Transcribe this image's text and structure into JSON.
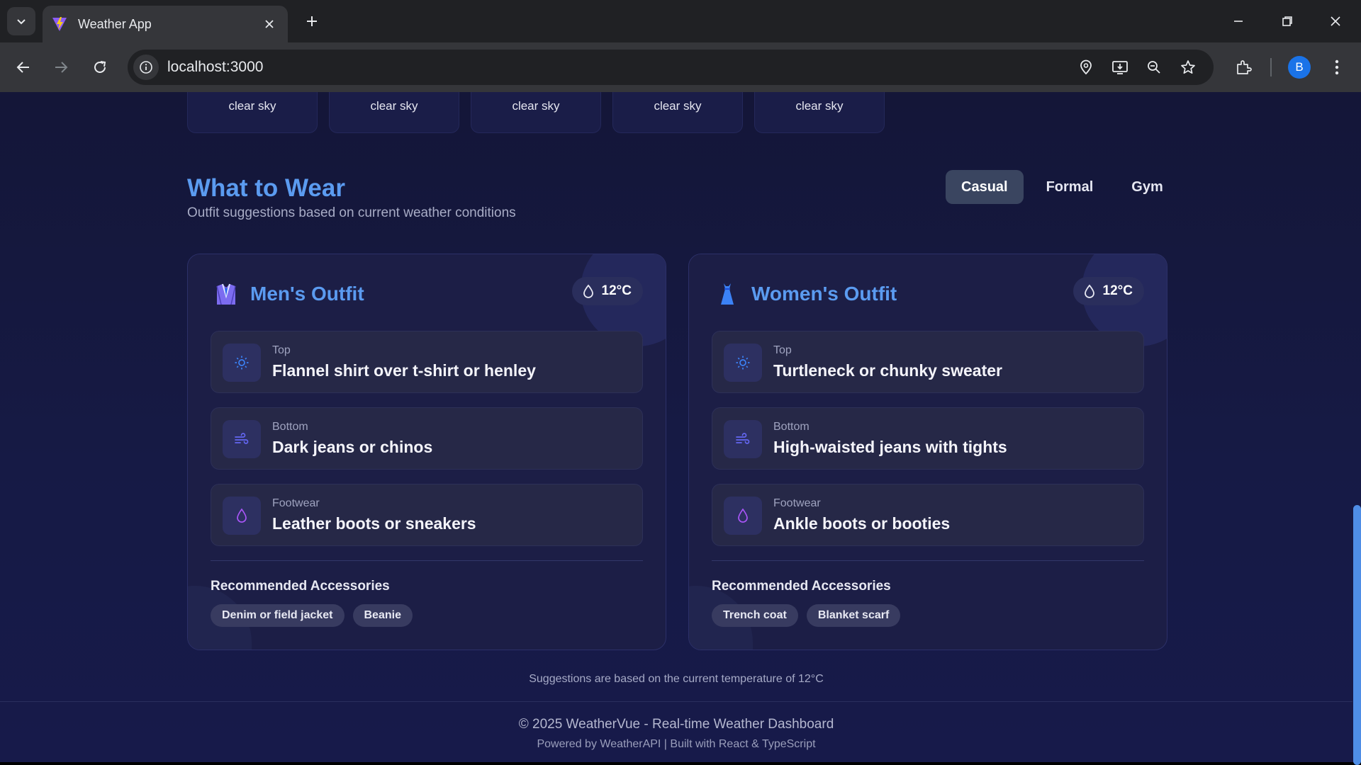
{
  "browser": {
    "tab_title": "Weather App",
    "url": "localhost:3000",
    "profile_initial": "B"
  },
  "forecast": {
    "descriptions": [
      "clear sky",
      "clear sky",
      "clear sky",
      "clear sky",
      "clear sky"
    ]
  },
  "wear": {
    "title": "What to Wear",
    "subtitle": "Outfit suggestions based on current weather conditions",
    "styles": [
      "Casual",
      "Formal",
      "Gym"
    ],
    "active_style": "Casual"
  },
  "men": {
    "title": "Men's Outfit",
    "temp": "12°C",
    "top_label": "Top",
    "top_value": "Flannel shirt over t-shirt or henley",
    "bottom_label": "Bottom",
    "bottom_value": "Dark jeans or chinos",
    "footwear_label": "Footwear",
    "footwear_value": "Leather boots or sneakers",
    "accessories_title": "Recommended Accessories",
    "accessories": [
      "Denim or field jacket",
      "Beanie"
    ]
  },
  "women": {
    "title": "Women's Outfit",
    "temp": "12°C",
    "top_label": "Top",
    "top_value": "Turtleneck or chunky sweater",
    "bottom_label": "Bottom",
    "bottom_value": "High-waisted jeans with tights",
    "footwear_label": "Footwear",
    "footwear_value": "Ankle boots or booties",
    "accessories_title": "Recommended Accessories",
    "accessories": [
      "Trench coat",
      "Blanket scarf"
    ]
  },
  "note": "Suggestions are based on the current temperature of 12°C",
  "footer": {
    "main": "© 2025 WeatherVue - Real-time Weather Dashboard",
    "sub": "Powered by WeatherAPI | Built with React & TypeScript"
  },
  "colors": {
    "accent": "#5b9bf0",
    "page_bg": "#161a45",
    "card_bg": "#1c1e46",
    "sun_icon": "#3b82f6",
    "wind_icon": "#6366f1",
    "drop_icon": "#a855f7"
  },
  "icons": {
    "top": "sun-icon",
    "bottom": "wind-icon",
    "footwear": "droplet-icon",
    "men": "shirt-icon",
    "women": "dress-icon",
    "temp": "droplet-icon"
  }
}
